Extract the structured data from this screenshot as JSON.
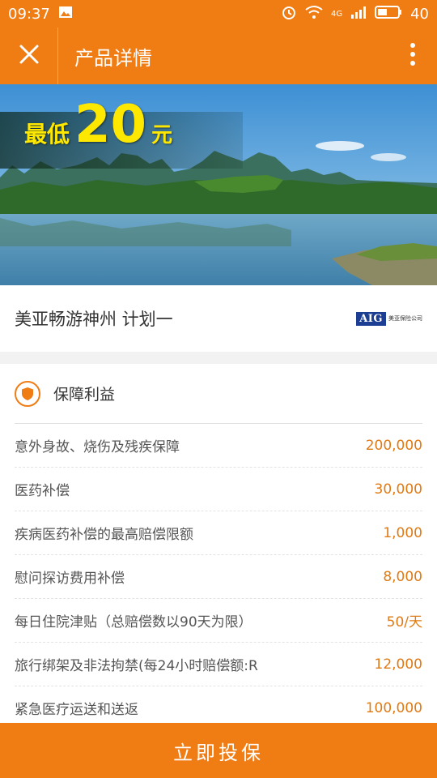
{
  "status_bar": {
    "time": "09:37",
    "network": "4G",
    "battery": "40"
  },
  "header": {
    "title": "产品详情"
  },
  "banner": {
    "price_prefix": "最低",
    "price_value": "20",
    "price_unit": "元"
  },
  "product": {
    "name": "美亚畅游神州 计划一",
    "insurer_logo_text": "AIG",
    "insurer_cn": "美亚保险公司"
  },
  "benefits": {
    "title": "保障利益",
    "rows": [
      {
        "label": "意外身故、烧伤及残疾保障",
        "value": "200,000"
      },
      {
        "label": "医药补偿",
        "value": "30,000"
      },
      {
        "label": "疾病医药补偿的最高赔偿限额",
        "value": "1,000"
      },
      {
        "label": "慰问探访费用补偿",
        "value": "8,000"
      },
      {
        "label": "每日住院津贴（总赔偿数以90天为限）",
        "value": "50/天"
      },
      {
        "label": "旅行绑架及非法拘禁(每24小时赔偿额:R",
        "value": "12,000"
      },
      {
        "label": "紧急医疗运送和送返",
        "value": "100,000"
      }
    ]
  },
  "cta": {
    "label": "立即投保"
  },
  "colors": {
    "accent": "#f07c14",
    "value_text": "#e07a14"
  }
}
